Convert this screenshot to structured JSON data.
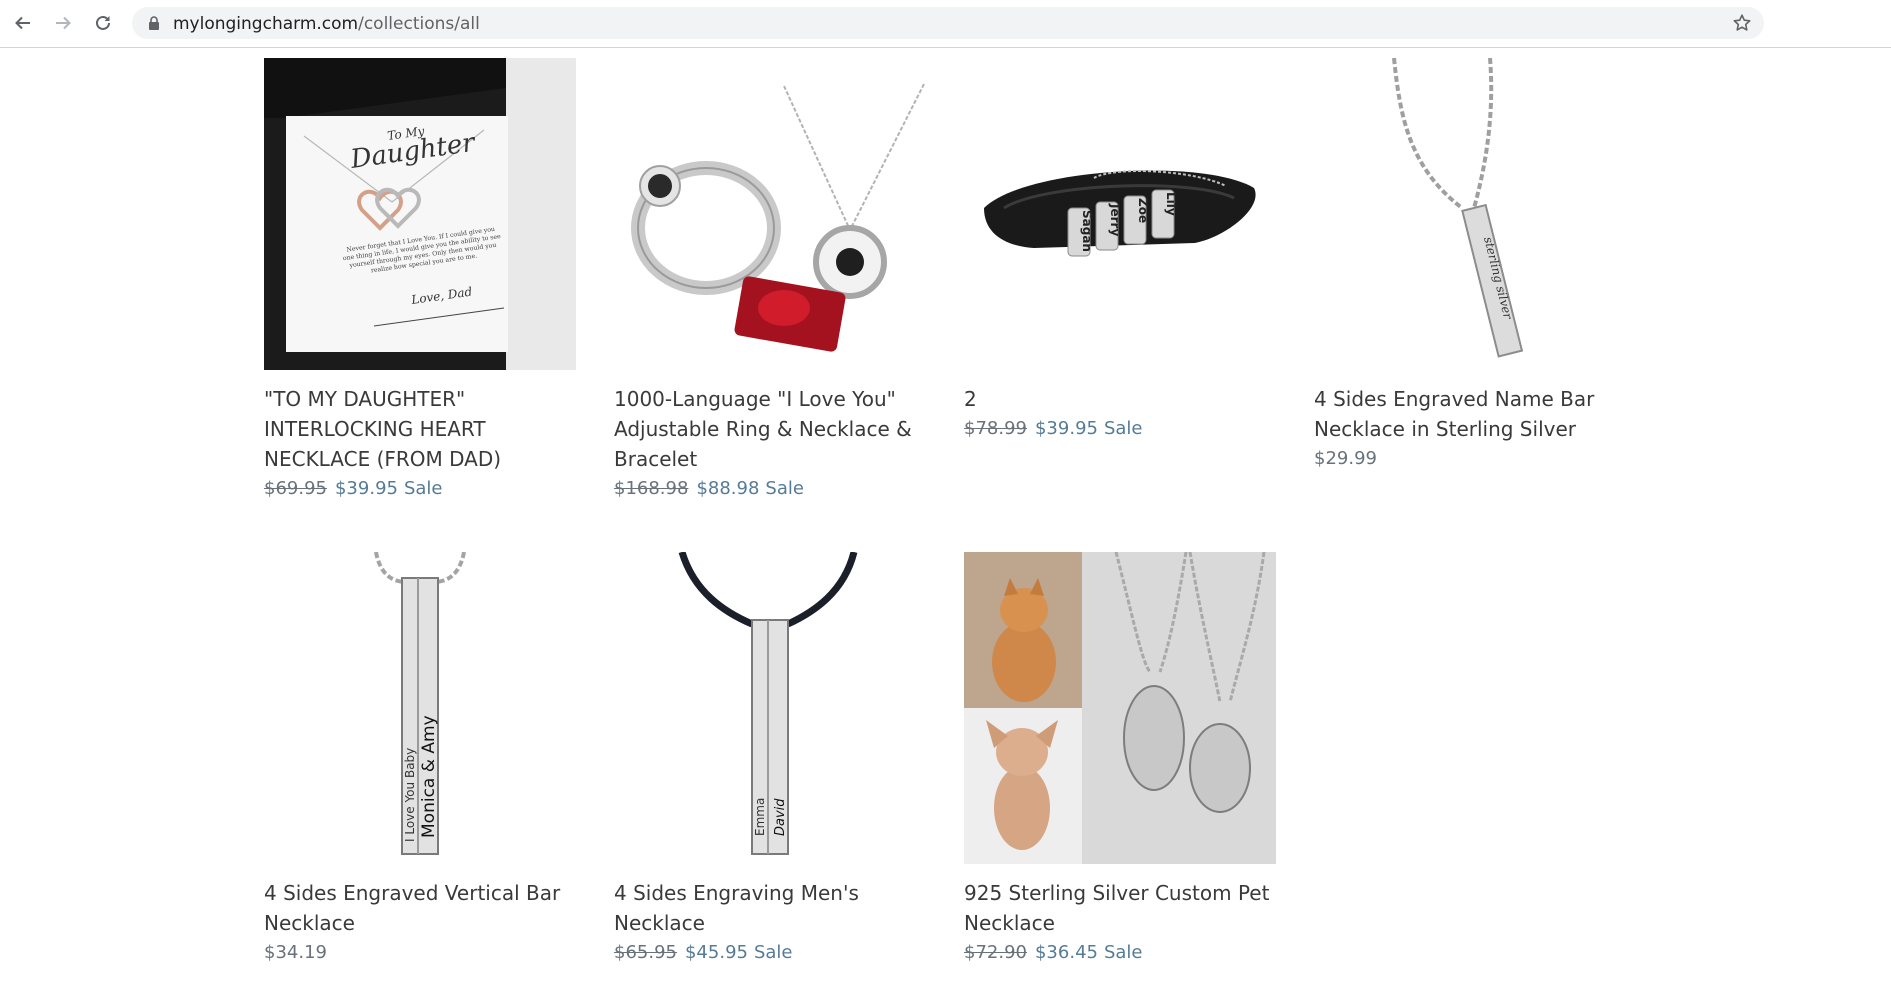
{
  "browser": {
    "url_domain": "mylongingcharm.com",
    "url_path": "/collections/all",
    "icons": [
      "back-arrow-icon",
      "forward-arrow-icon",
      "reload-icon",
      "lock-icon",
      "bookmark-star-icon"
    ]
  },
  "colors": {
    "title": "#3a3a3a",
    "compare_price": "#69727b",
    "sale_price": "#557b97",
    "page_bg": "#ffffff"
  },
  "products": [
    {
      "title": "\"TO MY DAUGHTER\" INTERLOCKING HEART NECKLACE (FROM DAD)",
      "compare_price": "$69.95",
      "price": "$39.95",
      "sale_label": "Sale",
      "image_text": {
        "heading_small": "To My",
        "heading": "Daughter",
        "message": "Never forget that I Love You. If I could give you one thing in life, I would give you the ability to see yourself through my eyes. Only then would you realize how special you are to me.",
        "signoff": "Love, Dad"
      }
    },
    {
      "title": "1000-Language \"I Love You\" Adjustable Ring & Necklace & Bracelet",
      "compare_price": "$168.98",
      "price": "$88.98",
      "sale_label": "Sale"
    },
    {
      "title": "2",
      "compare_price": "$78.99",
      "price": "$39.95",
      "sale_label": "Sale",
      "image_text": {
        "beads": [
          "Sagan",
          "Jerry",
          "Zoe",
          "Lily"
        ]
      }
    },
    {
      "title": "4 Sides Engraved Name Bar Necklace in Sterling Silver",
      "price": "$29.99",
      "image_text": {
        "engraving": "sterling silver"
      }
    },
    {
      "title": "4 Sides Engraved Vertical Bar Necklace",
      "price": "$34.19",
      "image_text": {
        "engraving_left": "I Love You Baby",
        "engraving_right": "Monica & Amy"
      }
    },
    {
      "title": "4 Sides Engraving Men's Necklace",
      "compare_price": "$65.95",
      "price": "$45.95",
      "sale_label": "Sale",
      "image_text": {
        "engraving_left": "Emma",
        "engraving_right": "David"
      }
    },
    {
      "title": "925 Sterling Silver Custom Pet Necklace",
      "compare_price": "$72.90",
      "price": "$36.45",
      "sale_label": "Sale"
    }
  ]
}
